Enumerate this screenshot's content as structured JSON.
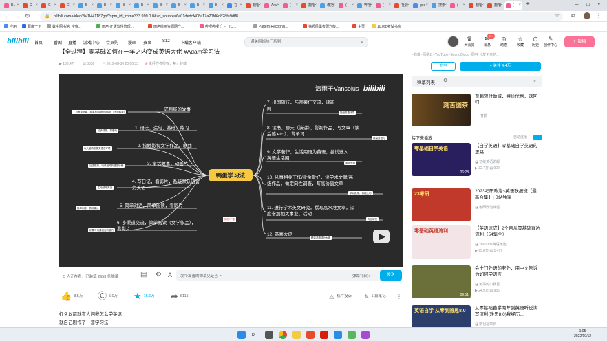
{
  "browser": {
    "tabs": [
      {
        "label": "B..",
        "active": false,
        "color": "#f25d8e"
      },
      {
        "label": "C",
        "active": false,
        "color": "#e84a2e"
      },
      {
        "label": "C",
        "active": false,
        "color": "#e84a2e"
      },
      {
        "label": "C",
        "active": false,
        "color": "#e84a2e"
      },
      {
        "label": "B",
        "active": false,
        "color": "#4aa0e6"
      },
      {
        "label": "B",
        "active": false,
        "color": "#4aa0e6"
      },
      {
        "label": "B",
        "active": false,
        "color": "#4aa0e6"
      },
      {
        "label": "B",
        "active": false,
        "color": "#4aa0e6"
      },
      {
        "label": "B",
        "active": false,
        "color": "#4aa0e6"
      },
      {
        "label": "B",
        "active": false,
        "color": "#4aa0e6"
      },
      {
        "label": "B",
        "active": false,
        "color": "#4aa0e6"
      },
      {
        "label": "B",
        "active": false,
        "color": "#4aa0e6"
      },
      {
        "label": "在",
        "active": false,
        "color": "#3c8ce7"
      },
      {
        "label": "翻唱",
        "active": false,
        "color": "#e84a2e"
      },
      {
        "label": "Ara",
        "active": false,
        "color": "#f25d8e"
      },
      {
        "label": "(",
        "active": false,
        "color": "#f25d8e"
      },
      {
        "label": "翻唱",
        "active": false,
        "color": "#e84a2e"
      },
      {
        "label": "囊括",
        "active": false,
        "color": "#4aa0e6"
      },
      {
        "label": "(",
        "active": false,
        "color": "#f25d8e"
      },
      {
        "label": "哔哩",
        "active": false,
        "color": "#4aa0e6"
      },
      {
        "label": "(",
        "active": false,
        "color": "#f25d8e"
      },
      {
        "label": "社会",
        "active": false,
        "color": "#e84a2e"
      },
      {
        "label": "goo",
        "active": false,
        "color": "#4a8af4"
      },
      {
        "label": "搜索",
        "active": false,
        "color": "#4aa0e6"
      },
      {
        "label": "(",
        "active": false,
        "color": "#f25d8e"
      },
      {
        "label": "翻唱",
        "active": false,
        "color": "#e84a2e"
      },
      {
        "label": "翻唱",
        "active": false,
        "color": "#e84a2e"
      },
      {
        "label": "(",
        "active": true,
        "color": "#f25d8e"
      }
    ],
    "new_tab": "+",
    "url": "bilibili.com/video/BV1l441187gp/?spm_id_from=333.999.0.0&vd_source=6e01dedcf408a17a20fd6d828fe9dff8",
    "bookmarks": [
      {
        "label": "应用",
        "color": "#4a8af4"
      },
      {
        "label": "百度一下",
        "color": "#2d6be4"
      },
      {
        "label": "数字图书馆_搜索...",
        "color": "#9e9e9e"
      },
      {
        "label": "雨声-正版软件管理...",
        "color": "#4caf50"
      },
      {
        "label": "雨声绘画资源网产...",
        "color": "#e84a2e"
      },
      {
        "label": "哔哩哔哩 (゜-゜)つ...",
        "color": "#f25d8e"
      },
      {
        "label": "Pattern Recogniti...",
        "color": "#9e9e9e"
      },
      {
        "label": "猫秀民属考研六级...",
        "color": "#e84a2e"
      },
      {
        "label": "主页",
        "color": "#e84a2e"
      },
      {
        "label": "10.0年考试书签",
        "color": "#f6c945"
      }
    ]
  },
  "bili": {
    "logo": "bilibili",
    "nav": [
      "首页",
      "番剧",
      "直播",
      "游戏中心",
      "会员购",
      "漫画",
      "赛事",
      "S12",
      "下载客户端"
    ],
    "search_placeholder": "通关网络热门系列!",
    "header_icons": [
      {
        "label": "大会员",
        "glyph": "♛"
      },
      {
        "label": "消息",
        "glyph": "✉"
      },
      {
        "label": "动态",
        "glyph": "◎"
      },
      {
        "label": "收藏",
        "glyph": "☆"
      },
      {
        "label": "历史",
        "glyph": "◷"
      },
      {
        "label": "创作中心",
        "glyph": "✎"
      }
    ],
    "badge": "99+",
    "upload": "投稿"
  },
  "video": {
    "title": "【全过程】零基础如何在一年之内变成英语大佬 #Adam学习法",
    "views": "188.4万",
    "danmaku_count": "3339",
    "date": "2019-08-30 20:00:33",
    "copyright_note": "未经作者授权，禁止转载",
    "watermark": "清雨子Vansolus",
    "watermark_logo": "bilibili"
  },
  "mindmap": {
    "center": "鸭蛋学习法",
    "left_nodes": [
      "成鸭蛋的故事",
      "1. 语法、造句、基础、练习",
      "2. 接触影视文学作品，歌曲",
      "3. 童话故事，动画片",
      "4. 写日记，看影片，系统默认语言为英语",
      "5. 简单对话，简单阅读，看影片",
      "6. 多渠道交流，简单阅读（文学作品），看影片"
    ],
    "left_tags": [
      "二月看英语翻，成英标(Sheen Adam（不得转载)",
      "初步成熟，打基础",
      "以大脑熟悉英文语言环境",
      "加强模拟，听读相关的语感培养",
      "主动使用英语",
      "简单训练，熟练确认",
      "积累与沟通语言的能力"
    ],
    "right_nodes": [
      "7. 出国旅行，与歪果仁交流，读新闻",
      "8. 读书，聊天（演讲），影视作品，写文章（读后感 etc.），背单词",
      "9. 文学著作，生活用语为英语，尝试进入英语生活圈",
      "10. 从事相关工作/业余爱好，读学术文献/高级作品，做定向性调查，写高价值文章",
      "11. 进行学术英文研究，撰写高水准文章，深度参加相关事业、活动",
      "12. 恭喜大佬"
    ],
    "right_tags": [
      "接触英语环境",
      "提高英语力",
      "英语思维",
      "学以致用，熟能生巧",
      "专业研究",
      "精益求精成为大佬"
    ],
    "center_bottom": "修改/丁基"
  },
  "danmaku_bar": {
    "watching": "5 人正在看，已装填 2953 条弹幕",
    "input_placeholder": "发个友善的弹幕见证当下",
    "etiquette": "弹幕礼仪 >",
    "send": "发送"
  },
  "actions": {
    "like": "8.5万",
    "coin": "5.0万",
    "favorite": "15.6万",
    "share": "6115",
    "report": "稿件投诉",
    "notes": "1 篇笔记"
  },
  "comments": [
    "好久以前就有人问我怎么学英语",
    "就自己剧作了一套学习法"
  ],
  "uploader": {
    "desc": "~商俊~网易云~YouTube~SoundCloud~同名 分发无亲的...",
    "charge": "充电",
    "follow": "+ 关注 4.4万"
  },
  "danmaku_list": "弹幕列表",
  "ad": {
    "title": "育鹏限时做减，特价优惠，速回归!",
    "source": "育鹏",
    "thumb_text": "刻苦图茶"
  },
  "next_up": {
    "label": "接下来播放",
    "autoplay": "自动连播"
  },
  "recommendations": [
    {
      "title": "【自学英语】零基础自学英语的思路",
      "up": "初级英语讲解",
      "views": "32.7万",
      "danmaku": "902",
      "duration": "06:28",
      "thumb_text": "零基础自学英语",
      "bg": "#2a1f5e"
    },
    {
      "title": "2023考研政治~英语联报班【最新合集】| B站独家",
      "up": "考研政治伴侣",
      "views": "",
      "danmaku": "",
      "duration": "",
      "thumb_text": "23考研",
      "bg": "#c0392b"
    },
    {
      "title": "【英语速成】2个月从零基础直达流利（54集全）",
      "up": "YouTube英语精选",
      "views": "95.8万",
      "danmaku": "1.4万",
      "duration": "",
      "thumb_text": "零基础英语流利",
      "bg": "#f3e4e8"
    },
    {
      "title": "会十门外语的老外，用中文告诉你如何学语言",
      "up": "无事的小我君",
      "views": "24.9万",
      "danmaku": "936",
      "duration": "09:51",
      "thumb_text": "",
      "bg": "#6b6f3a"
    },
    {
      "title": "从零基础自学两年到英语听说读写流利(雅思8.0)我经历...",
      "up": "斯坦福学长",
      "views": "",
      "danmaku": "",
      "duration": "",
      "thumb_text": "英语自学 从零到雅思8.0",
      "bg": "#2c3e6b"
    }
  ],
  "taskbar": {
    "time": "1:05",
    "date": "2022/10/12"
  }
}
